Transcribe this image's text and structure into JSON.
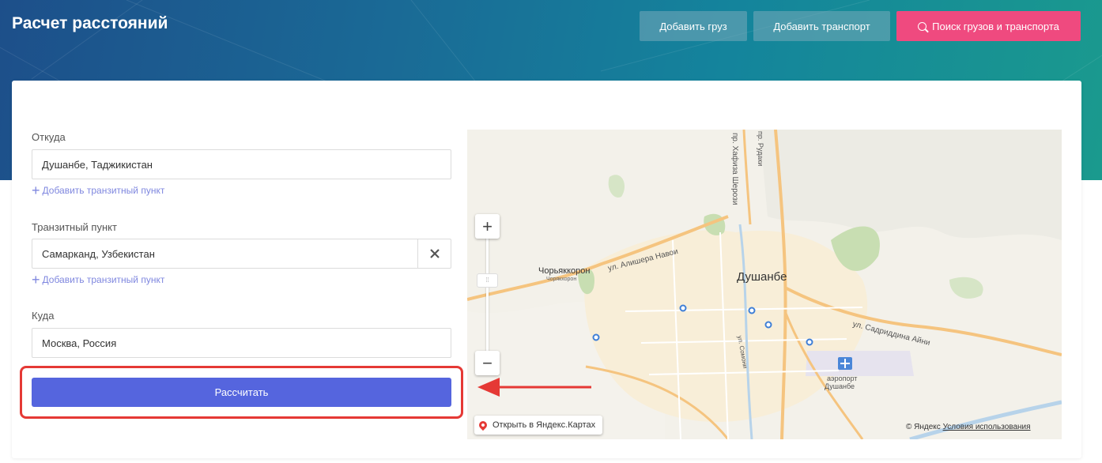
{
  "header": {
    "title": "Расчет расстояний",
    "add_cargo": "Добавить груз",
    "add_transport": "Добавить транспорт",
    "search": "Поиск грузов и транспорта"
  },
  "form": {
    "from_label": "Откуда",
    "from_value": "Душанбе, Таджикистан",
    "add_transit_1": "Добавить транзитный пункт",
    "transit_label": "Транзитный пункт",
    "transit_value": "Самарканд, Узбекистан",
    "add_transit_2": "Добавить транзитный пункт",
    "to_label": "Куда",
    "to_value": "Москва, Россия",
    "calculate": "Рассчитать"
  },
  "map": {
    "city": "Душанбе",
    "suburb": "Чорьяккорон",
    "suburb_small": "Чорякхорон",
    "street_navoi": "ул. Алишера Навои",
    "street_aini": "ул. Садриддина Айни",
    "street_shirozi": "пр. Хафиза Шерози",
    "street_rudaki": "пр. Рудаки",
    "street_somoni": "ул. Сомони",
    "airport_line1": "аэропорт",
    "airport_line2": "Душанбе",
    "open_in_yandex": "Открыть в Яндекс.Картах",
    "copyright": "© Яндекс",
    "terms": "Условия использования",
    "zoom_in": "+",
    "zoom_out": "−"
  },
  "colors": {
    "accent_button": "#5565de",
    "search_button": "#ef4a7f",
    "link": "#7f87df",
    "highlight": "#e53935"
  }
}
